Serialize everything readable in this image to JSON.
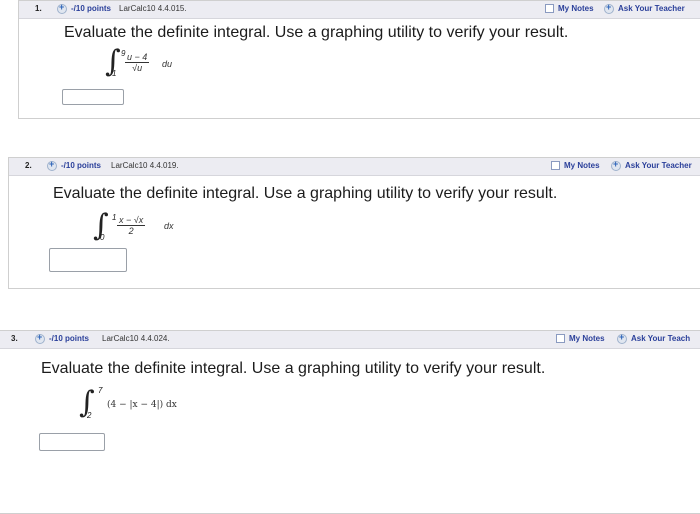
{
  "questions": [
    {
      "number": "1.",
      "points": "-/10 points",
      "source": "LarCalc10 4.4.015.",
      "my_notes": "My Notes",
      "ask_teacher": "Ask Your Teacher",
      "prompt": "Evaluate the definite integral. Use a graphing utility to verify your result.",
      "upper": "9",
      "lower": "1",
      "numerator": "u − 4",
      "denominator": "√u",
      "differential": "du"
    },
    {
      "number": "2.",
      "points": "-/10 points",
      "source": "LarCalc10 4.4.019.",
      "my_notes": "My Notes",
      "ask_teacher": "Ask Your Teacher",
      "prompt": "Evaluate the definite integral. Use a graphing utility to verify your result.",
      "upper": "1",
      "lower": "0",
      "numerator": "x − √x",
      "denominator": "2",
      "differential": "dx"
    },
    {
      "number": "3.",
      "points": "-/10 points",
      "source": "LarCalc10 4.4.024.",
      "my_notes": "My Notes",
      "ask_teacher": "Ask Your Teach",
      "prompt": "Evaluate the definite integral. Use a graphing utility to verify your result.",
      "upper": "7",
      "lower": "2",
      "integrand": "(4 − |x − 4|) dx"
    }
  ]
}
